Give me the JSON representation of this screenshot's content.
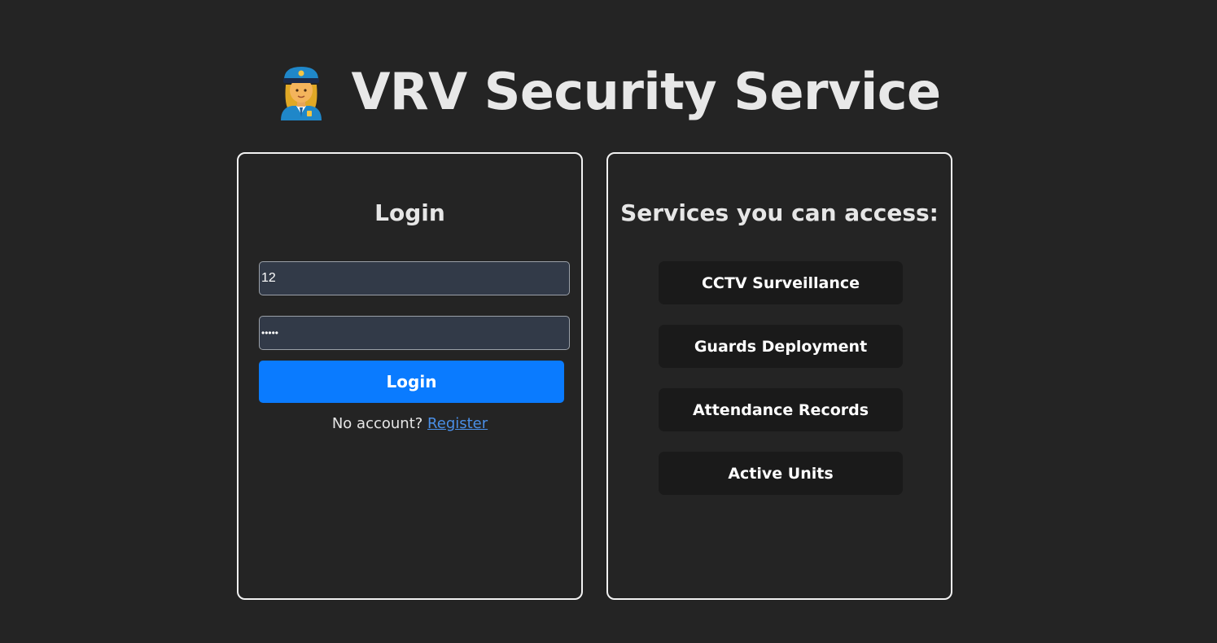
{
  "header": {
    "title": "VRV Security Service",
    "icon": "police-officer-icon"
  },
  "login": {
    "title": "Login",
    "username_value": "12",
    "password_value": "•••••",
    "button_label": "Login",
    "no_account_text": "No account?",
    "register_link": "Register"
  },
  "services": {
    "title": "Services you can access:",
    "items": [
      "CCTV Surveillance",
      "Guards Deployment",
      "Attendance Records",
      "Active Units"
    ]
  },
  "colors": {
    "background": "#242424",
    "accent": "#0a7bff",
    "input_bg": "#323a48",
    "service_bg": "#1a1a1a"
  }
}
